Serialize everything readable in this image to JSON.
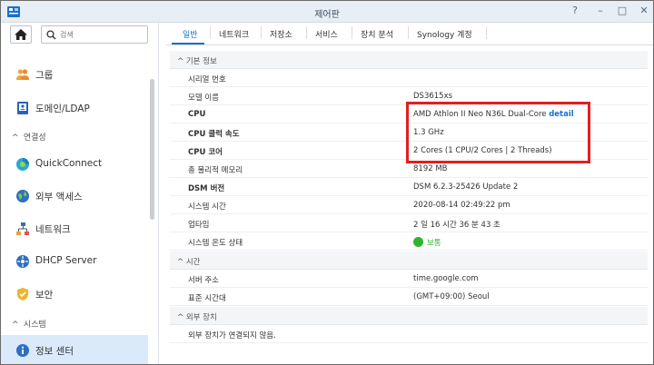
{
  "window": {
    "title": "제어판",
    "buttons": [
      "?",
      "–",
      "□",
      "✕"
    ]
  },
  "sidebar": {
    "search_placeholder": "검색",
    "items": [
      {
        "label": "그룹",
        "icon": "group-icon"
      },
      {
        "label": "도메인/LDAP",
        "icon": "domain-ldap-icon"
      },
      {
        "section": "연결성"
      },
      {
        "label": "QuickConnect",
        "icon": "quickconnect-icon"
      },
      {
        "label": "외부 액세스",
        "icon": "external-access-icon"
      },
      {
        "label": "네트워크",
        "icon": "network-icon"
      },
      {
        "label": "DHCP Server",
        "icon": "dhcp-server-icon"
      },
      {
        "label": "보안",
        "icon": "security-shield-icon"
      },
      {
        "section": "시스템"
      },
      {
        "label": "정보 센터",
        "icon": "info-center-icon",
        "active": true
      }
    ]
  },
  "tabs": [
    "일반",
    "네트워크",
    "저장소",
    "서비스",
    "장치 분석",
    "Synology 계정"
  ],
  "active_tab": "일반",
  "sections": {
    "basic": "기본 정보",
    "time": "시간",
    "external": "외부 장치"
  },
  "basic_info": {
    "serial_label": "시리얼 번호",
    "serial_value": "",
    "model_label": "모델 이름",
    "model_value": "DS3615xs",
    "cpu_label": "CPU",
    "cpu_value": "AMD Athlon II Neo N36L Dual-Core",
    "cpu_detail_link": "detail",
    "cpu_clock_label": "CPU 클럭 속도",
    "cpu_clock_value": "1.3 GHz",
    "cpu_cores_label": "CPU 코어",
    "cpu_cores_value": "2 Cores (1 CPU/2 Cores | 2 Threads)",
    "memory_label": "총 물리적 메모리",
    "memory_value": "8192 MB",
    "dsm_label": "DSM 버전",
    "dsm_value": "DSM 6.2.3-25426 Update 2",
    "system_time_label": "시스템 시간",
    "system_time_value": "2020-08-14 02:49:22 pm",
    "uptime_label": "업타임",
    "uptime_value": "2 일 16 시간 36 분 43 초",
    "temp_label": "시스템 온도 상태",
    "temp_value": "보통"
  },
  "time_info": {
    "server_label": "서버 주소",
    "server_value": "time.google.com",
    "timezone_label": "표준 시간대",
    "timezone_value": "(GMT+09:00) Seoul"
  },
  "external_info": {
    "message": "외부 장치가 연결되지 않음."
  },
  "colors": {
    "accent": "#1d6fc9",
    "status_ok": "#2db52d",
    "highlight": "#e02020",
    "active_nav_bg": "#dbeafa"
  }
}
